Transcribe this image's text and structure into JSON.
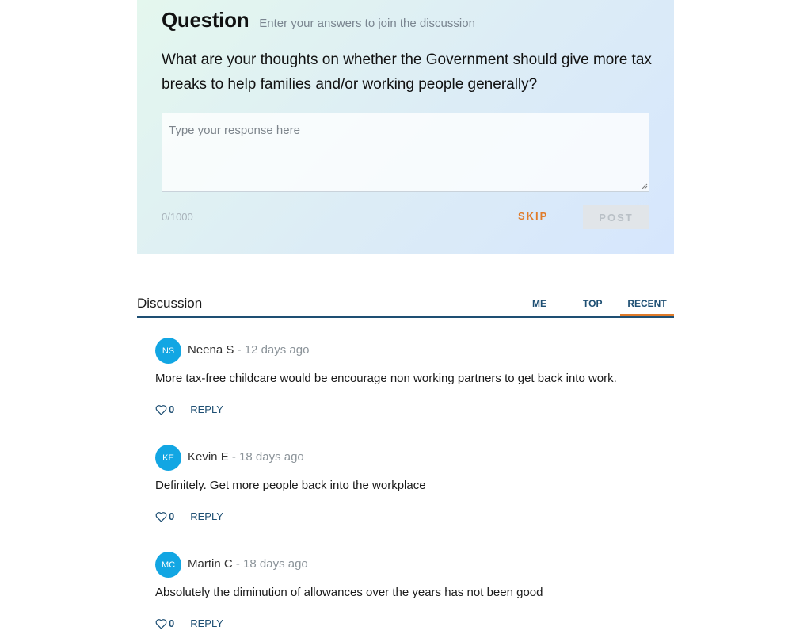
{
  "question": {
    "title": "Question",
    "subtitle": "Enter your answers to join the discussion",
    "text": "What are your thoughts on whether the Government should give more tax breaks to help families and/or working people generally?",
    "response_placeholder": "Type your response here",
    "char_count": "0/1000",
    "skip_label": "SKIP",
    "post_label": "POST"
  },
  "discussion": {
    "title": "Discussion",
    "tabs": [
      {
        "label": "ME"
      },
      {
        "label": "TOP"
      },
      {
        "label": "RECENT",
        "active": true
      }
    ]
  },
  "comments": [
    {
      "initials": "NS",
      "author": "Neena S",
      "separator": "-",
      "time": "12 days ago",
      "body": "More tax-free childcare would be encourage non working partners to get back into work.",
      "likes": "0",
      "reply_label": "REPLY"
    },
    {
      "initials": "KE",
      "author": "Kevin E",
      "separator": "-",
      "time": "18 days ago",
      "body": "Definitely. Get more people back into the workplace",
      "likes": "0",
      "reply_label": "REPLY"
    },
    {
      "initials": "MC",
      "author": "Martin C",
      "separator": "-",
      "time": "18 days ago",
      "body": "Absolutely the diminution of allowances over the years has not been good",
      "likes": "0",
      "reply_label": "REPLY"
    }
  ],
  "colors": {
    "accent_orange": "#e07b2a",
    "primary_navy": "#1e4f73",
    "avatar_blue": "#12a6e3"
  },
  "icons": {
    "like": "heart-outline-icon",
    "resize": "resize-grip-icon"
  }
}
